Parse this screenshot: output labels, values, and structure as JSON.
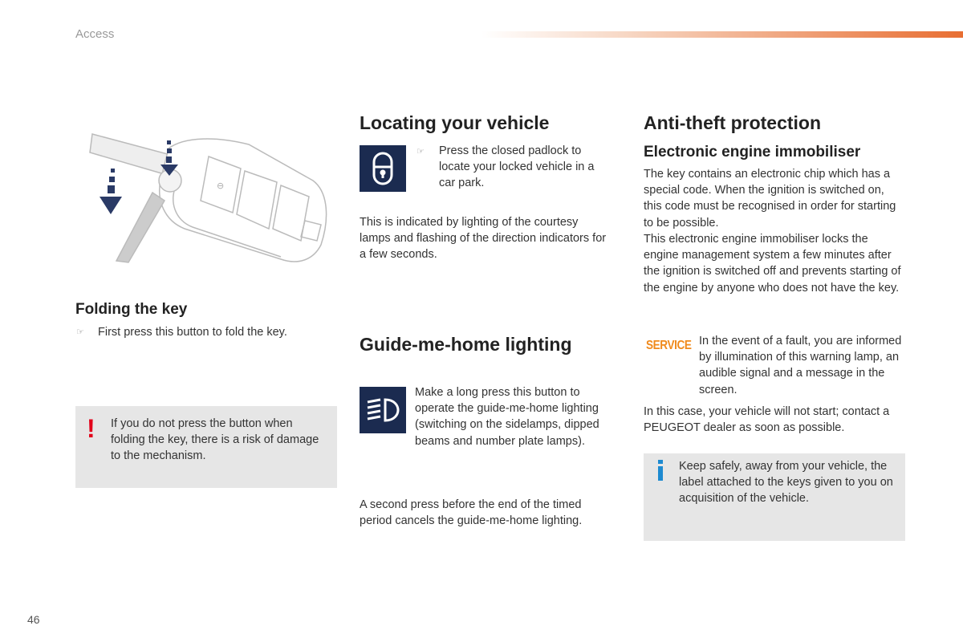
{
  "header": {
    "section": "Access",
    "accent_color": "#e86e32"
  },
  "page_number": "46",
  "folding": {
    "title": "Folding the key",
    "bullet_icon": "pointing-hand-icon",
    "instruction": "First press this button to fold the key.",
    "warning": "If you do not press the button when folding the key, there is a risk of damage to the mechanism."
  },
  "locating": {
    "title": "Locating your vehicle",
    "instruction": "Press the closed padlock to locate your locked vehicle in a car park.",
    "body": "This is indicated by lighting of the courtesy lamps and flashing of the direction indicators for a few seconds."
  },
  "guide": {
    "title": "Guide-me-home lighting",
    "instruction": "Make a long press this button to operate the guide-me-home lighting (switching on the sidelamps, dipped beams and number plate lamps).",
    "body": "A second press before the end of the timed period cancels the guide-me-home lighting."
  },
  "antitheft": {
    "title": "Anti-theft protection",
    "subtitle": "Electronic engine immobiliser",
    "body1": "The key contains an electronic chip which has a special code. When the ignition is switched on, this code must be recognised in order for starting to be possible.",
    "body2": "This electronic engine immobiliser locks the engine management system a few minutes after the ignition is switched off and prevents starting of the engine by anyone who does not have the key.",
    "service_lamp": "SERVICE",
    "service_color": "#f08a1c",
    "fault_text": "In the event of a fault, you are informed by illumination of this warning lamp, an audible signal and a message in the screen.",
    "case_text": "In this case, your vehicle will not start; contact a PEUGEOT dealer as soon as possible.",
    "info": "Keep safely, away from your vehicle, the label attached to the keys given to you on acquisition of the vehicle."
  }
}
